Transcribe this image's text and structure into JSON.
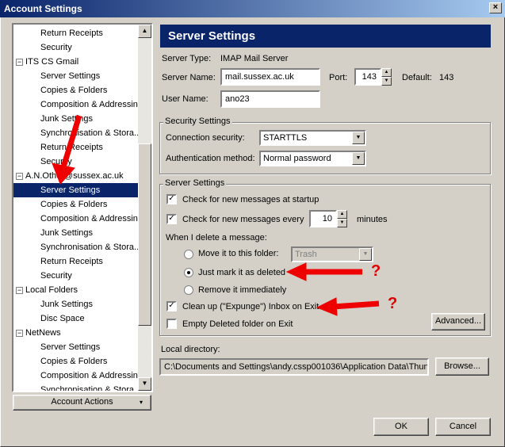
{
  "window": {
    "title": "Account Settings",
    "close_glyph": "×"
  },
  "tree": {
    "items": [
      {
        "label": "Return Receipts",
        "level": "child"
      },
      {
        "label": "Security",
        "level": "child"
      },
      {
        "label": "ITS CS Gmail",
        "level": "account"
      },
      {
        "label": "Server Settings",
        "level": "child"
      },
      {
        "label": "Copies & Folders",
        "level": "child"
      },
      {
        "label": "Composition & Addressing",
        "level": "child"
      },
      {
        "label": "Junk Settings",
        "level": "child"
      },
      {
        "label": "Synchronisation & Stora...",
        "level": "child"
      },
      {
        "label": "Return Receipts",
        "level": "child"
      },
      {
        "label": "Security",
        "level": "child"
      },
      {
        "label": "A.N.Other@sussex.ac.uk",
        "level": "account"
      },
      {
        "label": "Server Settings",
        "level": "child",
        "selected": true
      },
      {
        "label": "Copies & Folders",
        "level": "child"
      },
      {
        "label": "Composition & Addressing",
        "level": "child"
      },
      {
        "label": "Junk Settings",
        "level": "child"
      },
      {
        "label": "Synchronisation & Stora...",
        "level": "child"
      },
      {
        "label": "Return Receipts",
        "level": "child"
      },
      {
        "label": "Security",
        "level": "child"
      },
      {
        "label": "Local Folders",
        "level": "account"
      },
      {
        "label": "Junk Settings",
        "level": "child"
      },
      {
        "label": "Disc Space",
        "level": "child"
      },
      {
        "label": "NetNews",
        "level": "account"
      },
      {
        "label": "Server Settings",
        "level": "child"
      },
      {
        "label": "Copies & Folders",
        "level": "child"
      },
      {
        "label": "Composition & Addressing",
        "level": "child"
      },
      {
        "label": "Synchronisation & Stora...",
        "level": "child"
      }
    ],
    "expander_glyph": "−"
  },
  "account_actions_label": "Account Actions",
  "panel": {
    "title": "Server Settings",
    "server_type_label": "Server Type:",
    "server_type_value": "IMAP Mail Server",
    "server_name_label": "Server Name:",
    "server_name_value": "mail.sussex.ac.uk",
    "port_label": "Port:",
    "port_value": "143",
    "default_label": "Default:",
    "default_value": "143",
    "user_name_label": "User Name:",
    "user_name_value": "ano23"
  },
  "security": {
    "group_title": "Security Settings",
    "connection_label": "Connection security:",
    "connection_value": "STARTTLS",
    "auth_label": "Authentication method:",
    "auth_value": "Normal password"
  },
  "server_settings": {
    "group_title": "Server Settings",
    "check_startup_label": "Check for new messages at startup",
    "check_startup_checked": true,
    "check_every_label": "Check for new messages every",
    "check_every_checked": true,
    "check_every_value": "10",
    "minutes_label": "minutes",
    "delete_heading": "When I delete a message:",
    "move_label": "Move it to this folder:",
    "trash_value": "Trash",
    "mark_label": "Just mark it as deleted",
    "remove_label": "Remove it immediately",
    "selected_delete_option": "mark",
    "cleanup_label": "Clean up (\"Expunge\") Inbox on Exit",
    "cleanup_checked": true,
    "empty_label": "Empty Deleted folder on Exit",
    "empty_checked": false,
    "advanced_label": "Advanced..."
  },
  "local_dir": {
    "label": "Local directory:",
    "value": "C:\\Documents and Settings\\andy.cssp001036\\Application Data\\Thun",
    "browse_label": "Browse..."
  },
  "footer": {
    "ok_label": "OK",
    "cancel_label": "Cancel"
  },
  "annotations": {
    "question_mark": "?"
  },
  "colors": {
    "annotation_red": "#ee0000",
    "title_blue": "#0a246a"
  }
}
